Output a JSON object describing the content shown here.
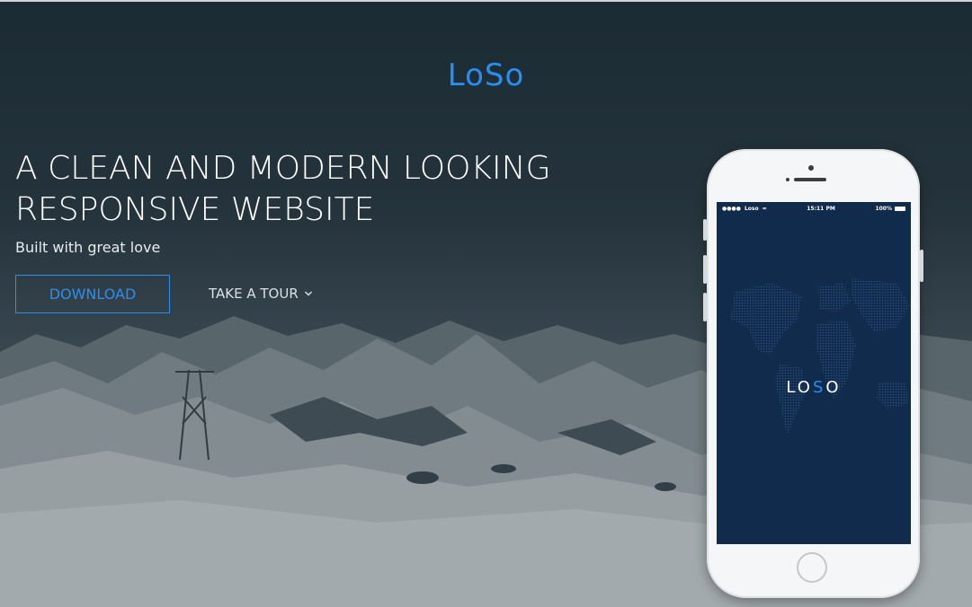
{
  "brand": {
    "logo_text": "LoSo",
    "accent_color": "#2a8ef0"
  },
  "hero": {
    "headline_line1": "A CLEAN AND MODERN LOOKING",
    "headline_line2": "RESPONSIVE WEBSITE",
    "tagline": "Built with great love",
    "download_label": "DOWNLOAD",
    "tour_label": "TAKE A TOUR",
    "tour_icon": "chevron-down-icon"
  },
  "phone": {
    "status_carrier": "Loso",
    "status_time": "15:11 PM",
    "status_battery": "100%",
    "screen_logo_prefix": "LO",
    "screen_logo_mark": "S",
    "screen_logo_suffix": "O",
    "screen_color": "#112b4d"
  }
}
